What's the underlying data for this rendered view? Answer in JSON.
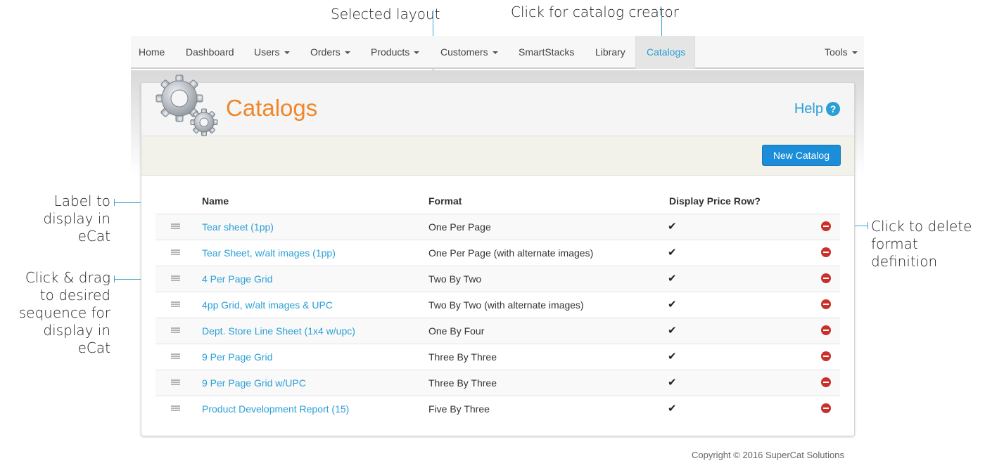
{
  "annotations": {
    "selected_layout": "Selected  layout",
    "catalog_creator": "Click for catalog creator",
    "label_to_display": "Label to\ndisplay in eCat",
    "click_drag": "Click  & drag\nto desired\nsequence for\ndisplay in eCat",
    "click_delete": "Click to delete\nformat definition"
  },
  "nav": {
    "home": "Home",
    "dashboard": "Dashboard",
    "users": "Users",
    "orders": "Orders",
    "products": "Products",
    "customers": "Customers",
    "smartstacks": "SmartStacks",
    "library": "Library",
    "catalogs": "Catalogs",
    "tools": "Tools",
    "active": "Catalogs"
  },
  "page": {
    "title": "Catalogs",
    "help": "Help",
    "help_icon": "?",
    "new_button": "New Catalog",
    "accent_color": "#f0862a",
    "link_color": "#2a9fd6"
  },
  "table": {
    "columns": {
      "name": "Name",
      "format": "Format",
      "price": "Display Price Row?"
    },
    "rows": [
      {
        "name": "Tear sheet (1pp)",
        "format": "One Per Page",
        "price": "✔"
      },
      {
        "name": "Tear Sheet, w/alt images (1pp)",
        "format": "One Per Page (with alternate images)",
        "price": "✔"
      },
      {
        "name": "4 Per Page Grid",
        "format": "Two By Two",
        "price": "✔"
      },
      {
        "name": "4pp Grid, w/alt images & UPC",
        "format": "Two By Two (with alternate images)",
        "price": "✔"
      },
      {
        "name": "Dept. Store Line Sheet (1x4 w/upc)",
        "format": "One By Four",
        "price": "✔"
      },
      {
        "name": "9 Per Page Grid",
        "format": "Three By Three",
        "price": "✔"
      },
      {
        "name": "9 Per Page Grid w/UPC",
        "format": "Three By Three",
        "price": "✔"
      },
      {
        "name": "Product Development Report (15)",
        "format": "Five By Three",
        "price": "✔"
      }
    ]
  },
  "footer": {
    "copyright": "Copyright © 2016 SuperCat Solutions"
  }
}
